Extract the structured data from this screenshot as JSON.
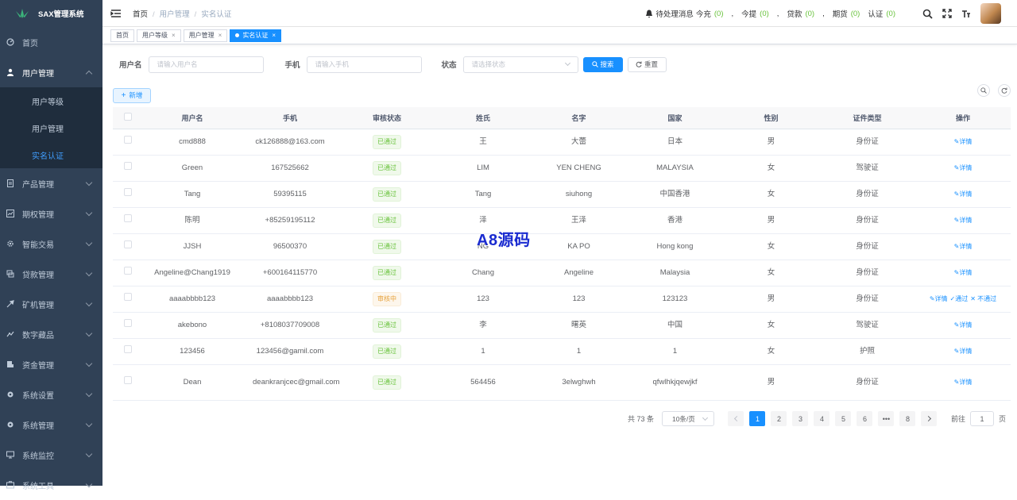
{
  "app": {
    "title": "SAX管理系统"
  },
  "sidebar": {
    "items": [
      {
        "label": "首页",
        "icon": "dashboard-icon"
      },
      {
        "label": "用户管理",
        "icon": "user-icon",
        "expanded": true
      },
      {
        "label": "产品管理",
        "icon": "document-icon"
      },
      {
        "label": "期权管理",
        "icon": "chart-icon"
      },
      {
        "label": "智能交易",
        "icon": "gear-icon"
      },
      {
        "label": "贷款管理",
        "icon": "loan-icon"
      },
      {
        "label": "矿机管理",
        "icon": "build-icon"
      },
      {
        "label": "数字藏品",
        "icon": "collection-icon"
      },
      {
        "label": "资金管理",
        "icon": "money-icon"
      },
      {
        "label": "系统设置",
        "icon": "setting-icon"
      },
      {
        "label": "系统管理",
        "icon": "system-icon"
      },
      {
        "label": "系统监控",
        "icon": "monitor-icon"
      },
      {
        "label": "系统工具",
        "icon": "tool-icon"
      }
    ],
    "submenu": [
      {
        "label": "用户等级"
      },
      {
        "label": "用户管理"
      },
      {
        "label": "实名认证",
        "active": true
      }
    ]
  },
  "navbar": {
    "breadcrumb": [
      "首页",
      "用户管理",
      "实名认证"
    ],
    "notice_label": "待处理消息",
    "notices": [
      {
        "label": "今充",
        "count": "(0)"
      },
      {
        "label": "今提",
        "count": "(0)"
      },
      {
        "label": "贷款",
        "count": "(0)"
      },
      {
        "label": "期货",
        "count": "(0)"
      },
      {
        "label": "认证",
        "count": "(0)"
      }
    ],
    "separator": ","
  },
  "tags": [
    {
      "label": "首页",
      "closable": false
    },
    {
      "label": "用户等级",
      "closable": true
    },
    {
      "label": "用户管理",
      "closable": true
    },
    {
      "label": "实名认证",
      "closable": true,
      "active": true
    }
  ],
  "tag_close": "×",
  "search": {
    "username_label": "用户名",
    "username_placeholder": "请输入用户名",
    "phone_label": "手机",
    "phone_placeholder": "请输入手机",
    "status_label": "状态",
    "status_placeholder": "请选择状态",
    "search_btn": "搜索",
    "reset_btn": "重置"
  },
  "toolbar": {
    "add_btn": "新增"
  },
  "table": {
    "headers": [
      "用户名",
      "手机",
      "审核状态",
      "姓氏",
      "名字",
      "国家",
      "性别",
      "证件类型",
      "操作"
    ],
    "rows": [
      {
        "username": "cmd888",
        "phone": "ck126888@163.com",
        "status": "已通过",
        "status_type": "pass",
        "surname": "王",
        "name": "大蕾",
        "country": "日本",
        "gender": "男",
        "id_type": "身份证"
      },
      {
        "username": "Green",
        "phone": "167525662",
        "status": "已通过",
        "status_type": "pass",
        "surname": "LIM",
        "name": "YEN CHENG",
        "country": "MALAYSIA",
        "gender": "女",
        "id_type": "驾驶证"
      },
      {
        "username": "Tang",
        "phone": "59395115",
        "status": "已通过",
        "status_type": "pass",
        "surname": "Tang",
        "name": "siuhong",
        "country": "中国香港",
        "gender": "女",
        "id_type": "身份证"
      },
      {
        "username": "陈明",
        "phone": "+85259195112",
        "status": "已通过",
        "status_type": "pass",
        "surname": "泽",
        "name": "王泽",
        "country": "香港",
        "gender": "男",
        "id_type": "身份证"
      },
      {
        "username": "JJSH",
        "phone": "96500370",
        "status": "已通过",
        "status_type": "pass",
        "surname": "NG",
        "name": "KA PO",
        "country": "Hong kong",
        "gender": "女",
        "id_type": "身份证"
      },
      {
        "username": "Angeline@Chang1919",
        "phone": "+600164115770",
        "status": "已通过",
        "status_type": "pass",
        "surname": "Chang",
        "name": "Angeline",
        "country": "Malaysia",
        "gender": "女",
        "id_type": "身份证"
      },
      {
        "username": "aaaabbbb123",
        "phone": "aaaabbbb123",
        "status": "审核中",
        "status_type": "pending",
        "surname": "123",
        "name": "123",
        "country": "123123",
        "gender": "男",
        "id_type": "身份证"
      },
      {
        "username": "akebono",
        "phone": "+8108037709008",
        "status": "已通过",
        "status_type": "pass",
        "surname": "李",
        "name": "曙英",
        "country": "中国",
        "gender": "女",
        "id_type": "驾驶证"
      },
      {
        "username": "123456",
        "phone": "123456@gamil.com",
        "status": "已通过",
        "status_type": "pass",
        "surname": "1",
        "name": "1",
        "country": "1",
        "gender": "女",
        "id_type": "护照"
      },
      {
        "username": "Dean",
        "phone": "deankranjcec@gmail.com",
        "status": "已通过",
        "status_type": "pass",
        "surname": "564456",
        "name": "3elwghwh",
        "country": "qfwlhkjqewjkf",
        "gender": "男",
        "id_type": "身份证"
      }
    ],
    "op_detail": "详情",
    "op_pass": "通过",
    "op_reject": "不通过"
  },
  "pager": {
    "total": "共 73 条",
    "page_size": "10条/页",
    "pages": [
      "1",
      "2",
      "3",
      "4",
      "5",
      "6",
      "•••",
      "8"
    ],
    "current": "1",
    "goto_label": "前往",
    "goto_value": "1",
    "page_suffix": "页"
  },
  "watermark": "A8源码",
  "colors": {
    "sidebar_bg": "#304156",
    "primary": "#1890ff",
    "success": "#67c23a",
    "warning": "#e6a23c"
  }
}
